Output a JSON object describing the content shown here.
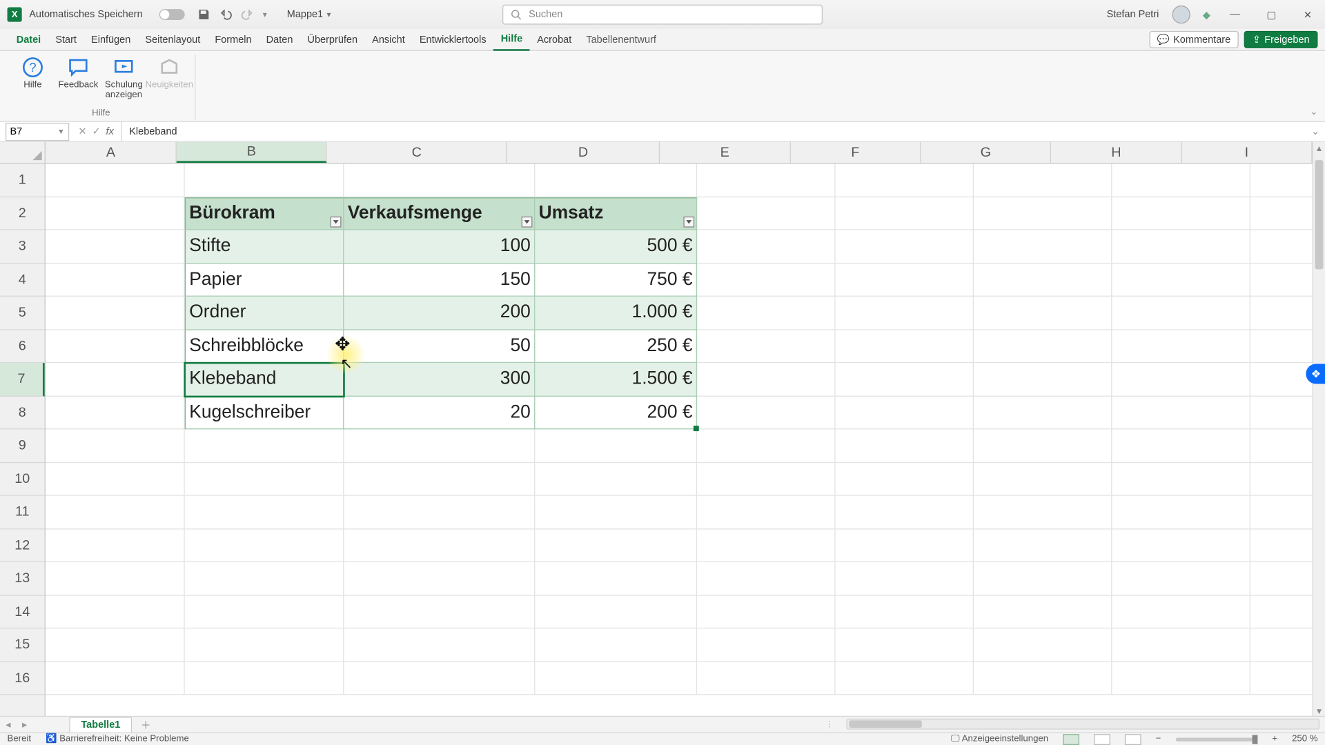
{
  "titlebar": {
    "autosave_label": "Automatisches Speichern",
    "doc_name": "Mappe1",
    "search_placeholder": "Suchen",
    "user_name": "Stefan Petri"
  },
  "tabs": {
    "file": "Datei",
    "items": [
      "Start",
      "Einfügen",
      "Seitenlayout",
      "Formeln",
      "Daten",
      "Überprüfen",
      "Ansicht",
      "Entwicklertools",
      "Hilfe",
      "Acrobat",
      "Tabellenentwurf"
    ],
    "active": "Hilfe",
    "comments": "Kommentare",
    "share": "Freigeben"
  },
  "ribbon": {
    "buttons": [
      {
        "label": "Hilfe",
        "disabled": false
      },
      {
        "label": "Feedback",
        "disabled": false
      },
      {
        "label": "Schulung anzeigen",
        "disabled": false
      },
      {
        "label": "Neuigkeiten",
        "disabled": true
      }
    ],
    "group_label": "Hilfe"
  },
  "fbar": {
    "namebox": "B7",
    "formula": "Klebeband"
  },
  "columns": [
    "A",
    "B",
    "C",
    "D",
    "E",
    "F",
    "G",
    "H",
    "I"
  ],
  "rows": [
    "1",
    "2",
    "3",
    "4",
    "5",
    "6",
    "7",
    "8",
    "9",
    "10",
    "11",
    "12",
    "13",
    "14",
    "15",
    "16"
  ],
  "selected_col": "B",
  "selected_row": "7",
  "table": {
    "headers": [
      "Bürokram",
      "Verkaufsmenge",
      "Umsatz"
    ],
    "rows": [
      {
        "name": "Stifte",
        "qty": "100",
        "rev": "500 €"
      },
      {
        "name": "Papier",
        "qty": "150",
        "rev": "750 €"
      },
      {
        "name": "Ordner",
        "qty": "200",
        "rev": "1.000 €"
      },
      {
        "name": "Schreibblöcke",
        "qty": "50",
        "rev": "250 €"
      },
      {
        "name": "Klebeband",
        "qty": "300",
        "rev": "1.500 €"
      },
      {
        "name": "Kugelschreiber",
        "qty": "20",
        "rev": "200 €"
      }
    ]
  },
  "sheet": {
    "tab": "Tabelle1"
  },
  "status": {
    "ready": "Bereit",
    "accessibility": "Barrierefreiheit: Keine Probleme",
    "display_settings": "Anzeigeeinstellungen",
    "zoom": "250 %"
  }
}
